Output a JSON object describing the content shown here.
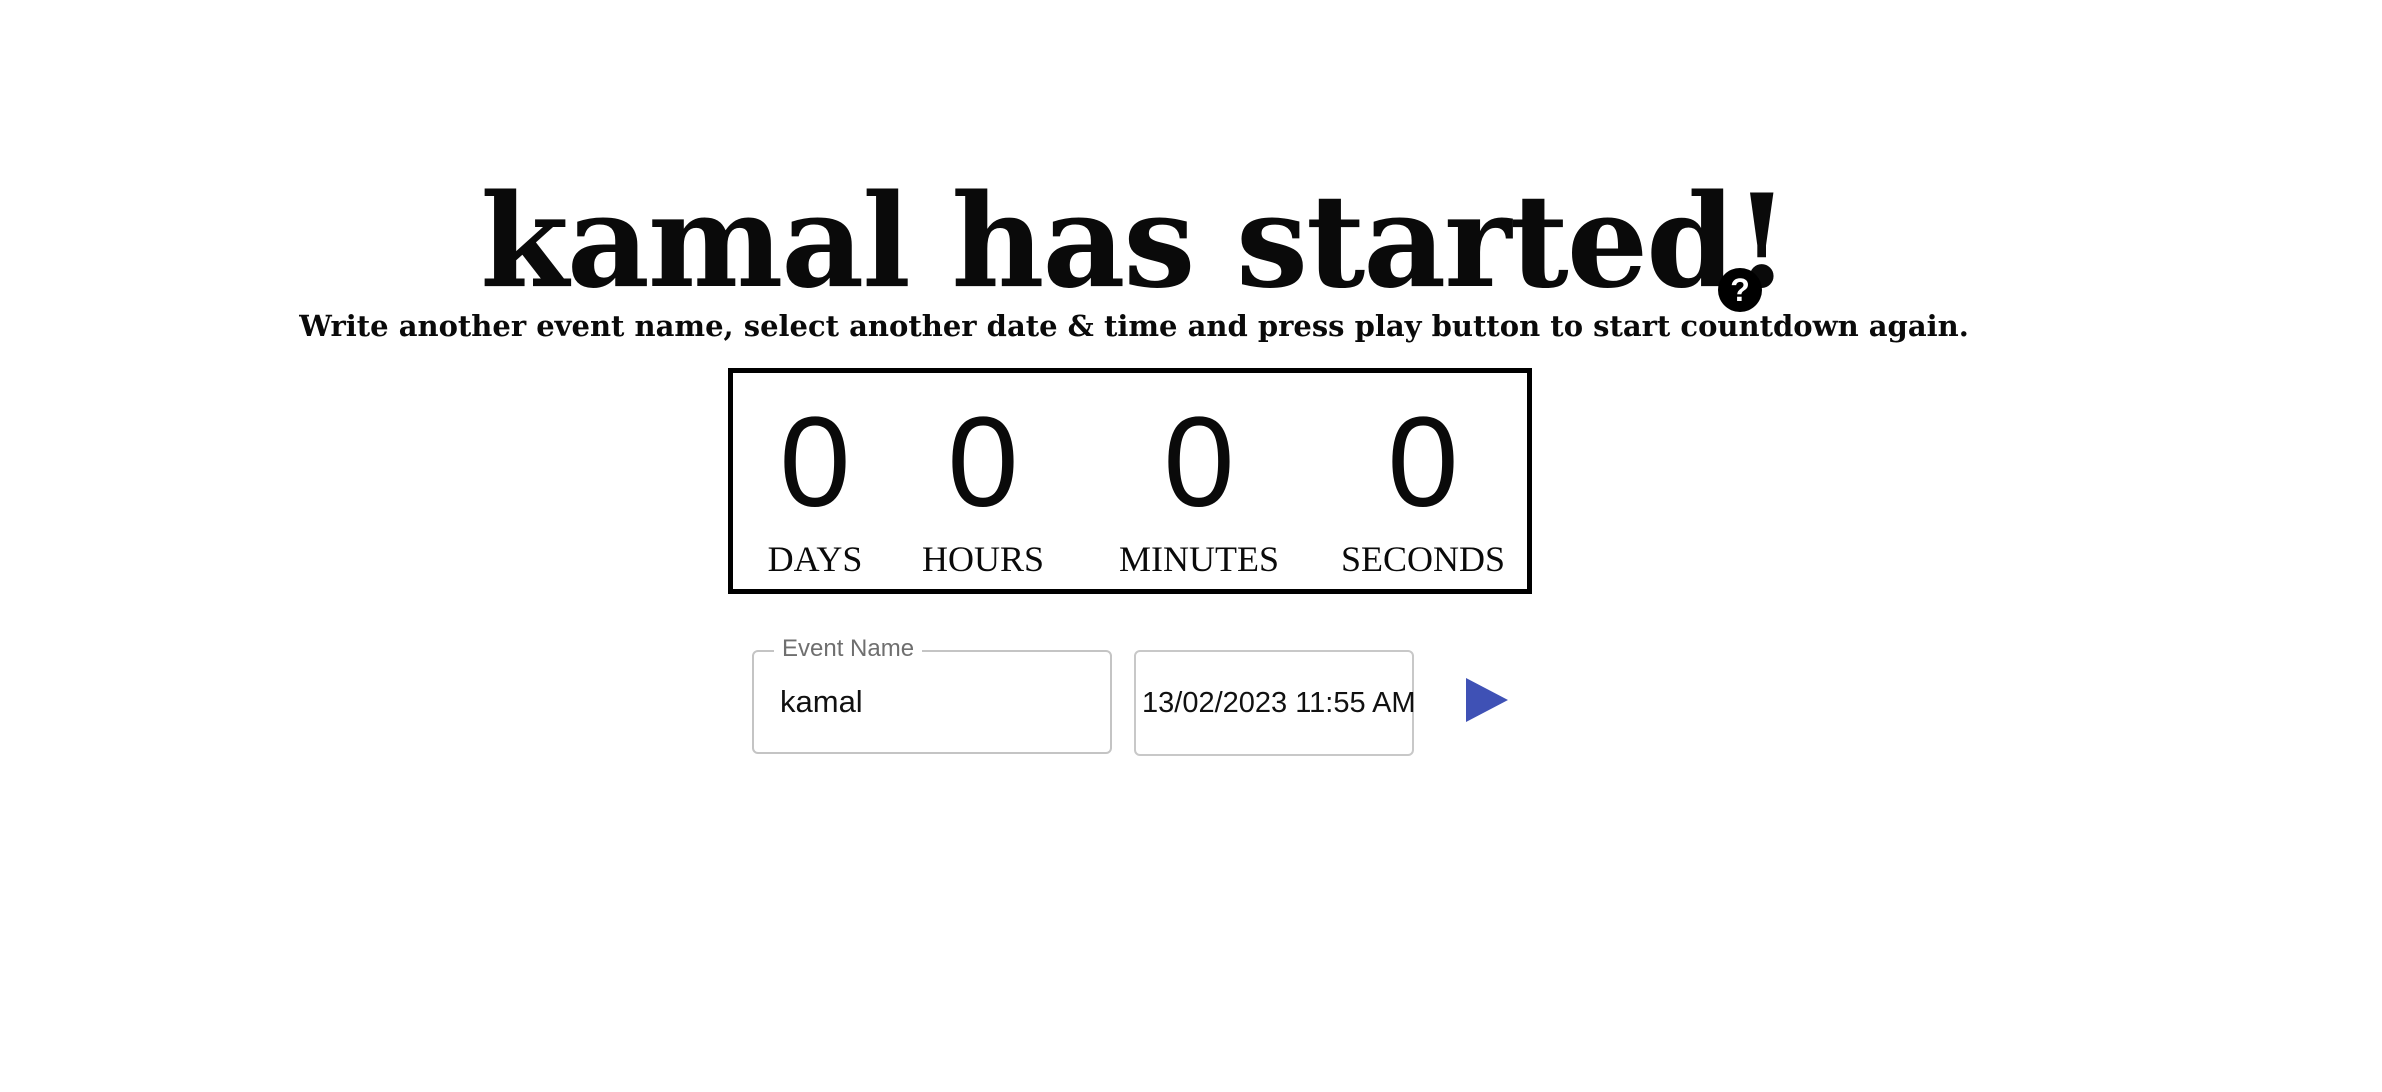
{
  "header": {
    "title": "kamal has started!",
    "help_icon": "?",
    "subtitle": "Write another event name, select another date & time and press play button to start countdown again."
  },
  "countdown": {
    "units": [
      {
        "value": "0",
        "label": "DAYS"
      },
      {
        "value": "0",
        "label": "HOURS"
      },
      {
        "value": "0",
        "label": "MINUTES"
      },
      {
        "value": "0",
        "label": "SECONDS"
      }
    ]
  },
  "form": {
    "event_name_label": "Event Name",
    "event_name_value": "kamal",
    "datetime_value": "13/02/2023 11:55 AM",
    "play_icon": "play-icon"
  },
  "colors": {
    "play_button": "#3f51b5",
    "text": "#0a0a0a",
    "field_border": "#c4c4c4"
  }
}
